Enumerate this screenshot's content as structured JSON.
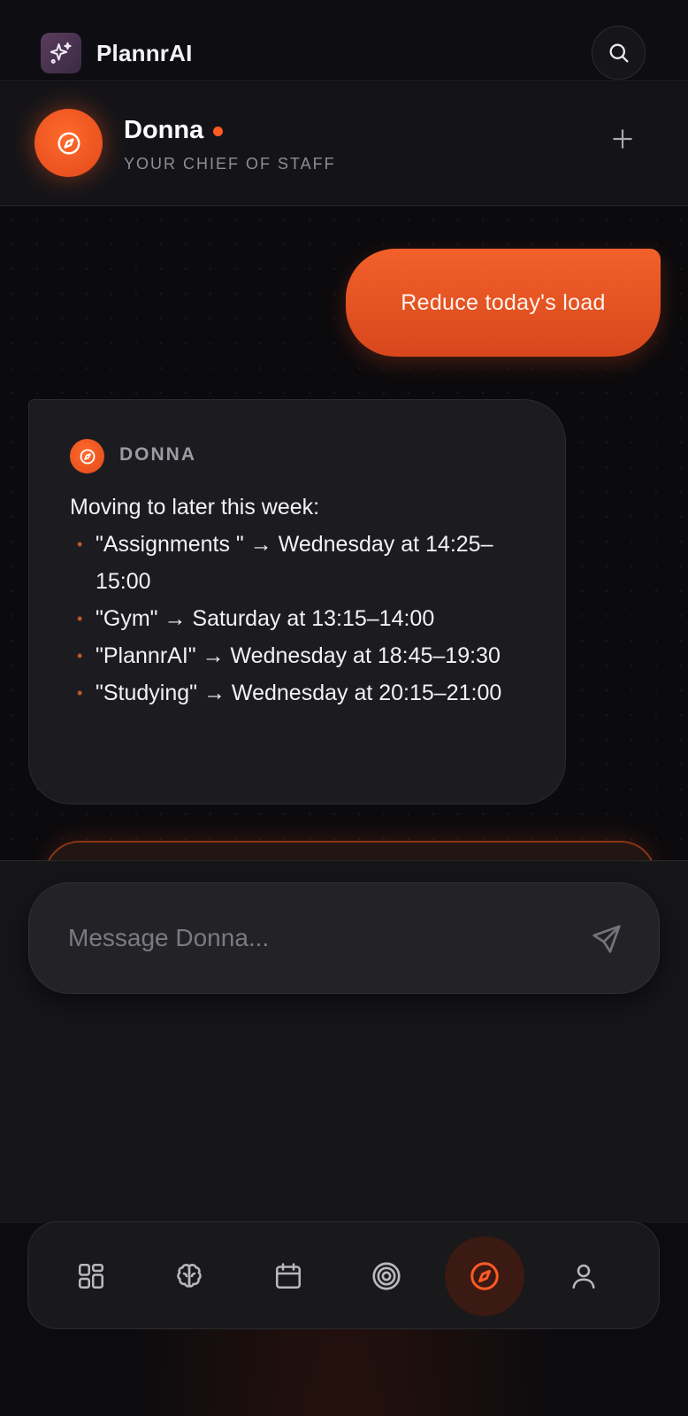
{
  "app": {
    "title": "PlannrAI",
    "logo_icon": "sparkles-icon",
    "accent_color": "#f05a24"
  },
  "header": {
    "search_icon": "search-icon"
  },
  "assistant": {
    "name": "Donna",
    "role": "YOUR CHIEF OF STAFF",
    "status": "online",
    "avatar_icon": "compass-icon",
    "new_chat_icon": "plus-icon"
  },
  "chat": {
    "messages": [
      {
        "sender": "user",
        "text": "Reduce today's load"
      },
      {
        "sender": "assistant",
        "sender_label": "DONNA",
        "intro": "Moving to later this week:",
        "items": [
          "\"Assignments \" → Wednesday at 14:25–15:00",
          "\"Gym\" → Saturday at 13:15–14:00",
          "\"PlannrAI\" → Wednesday at 18:45–19:30",
          "\"Studying\" → Wednesday at 20:15–21:00"
        ],
        "bullet": "•"
      }
    ]
  },
  "composer": {
    "placeholder": "Message Donna...",
    "send_icon": "send-icon"
  },
  "nav": {
    "items": [
      {
        "name": "dashboard",
        "icon": "grid-icon",
        "active": false
      },
      {
        "name": "brain",
        "icon": "brain-icon",
        "active": false
      },
      {
        "name": "calendar",
        "icon": "calendar-icon",
        "active": false
      },
      {
        "name": "goals",
        "icon": "target-icon",
        "active": false
      },
      {
        "name": "assistant",
        "icon": "compass-icon",
        "active": true
      },
      {
        "name": "profile",
        "icon": "user-icon",
        "active": false
      }
    ]
  }
}
